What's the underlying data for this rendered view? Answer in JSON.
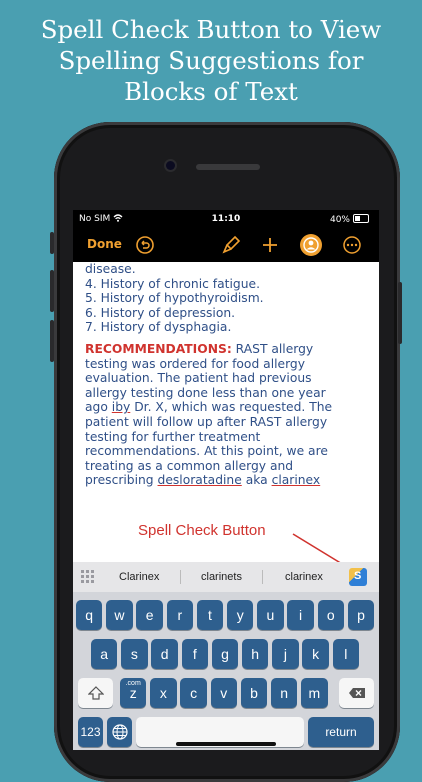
{
  "headline": [
    "Spell Check Button to View",
    "Spelling Suggestions for",
    "Blocks of Text"
  ],
  "status": {
    "carrier": "No SIM",
    "time": "11:10",
    "battery": "40%"
  },
  "toolbar": {
    "done_label": "Done"
  },
  "document": {
    "lines": [
      "disease.",
      "4. History of chronic fatigue.",
      "5. History of hypothyroidism.",
      "6. History of depression.",
      "7. History of dysphagia."
    ],
    "rec_label": "RECOMMENDATIONS:",
    "rec_first": " RAST allergy",
    "para": [
      "testing was ordered for food allergy",
      "evaluation. The patient had previous",
      "allergy testing done less than one year"
    ],
    "line_iby": {
      "before": "ago ",
      "word": "iby",
      "after": " Dr. X, which was requested. The"
    },
    "para2": [
      "patient will follow up after RAST allergy",
      "testing for further treatment",
      "recommendations. At this point, we are",
      "treating as a common allergy and"
    ],
    "last_line": {
      "before": "prescribing ",
      "word1": "desloratadine",
      "mid": " aka ",
      "word2": "clarinex"
    }
  },
  "annotation": "Spell Check Button",
  "suggestions": [
    "Clarinex",
    "clarinets",
    "clarinex"
  ],
  "spell_button_label": "S",
  "keyboard": {
    "row1": [
      "q",
      "w",
      "e",
      "r",
      "t",
      "y",
      "u",
      "i",
      "o",
      "p"
    ],
    "row2": [
      "a",
      "s",
      "d",
      "f",
      "g",
      "h",
      "j",
      "k",
      "l"
    ],
    "row3": [
      "z",
      "x",
      "c",
      "v",
      "b",
      "n",
      "m"
    ],
    "z_hint": ".com",
    "numbers_key": "123",
    "return_key": "return"
  },
  "colors": {
    "accent": "#f0a030",
    "text": "#2f4f87",
    "rec": "#d0332e",
    "key": "#2e5f8e"
  }
}
